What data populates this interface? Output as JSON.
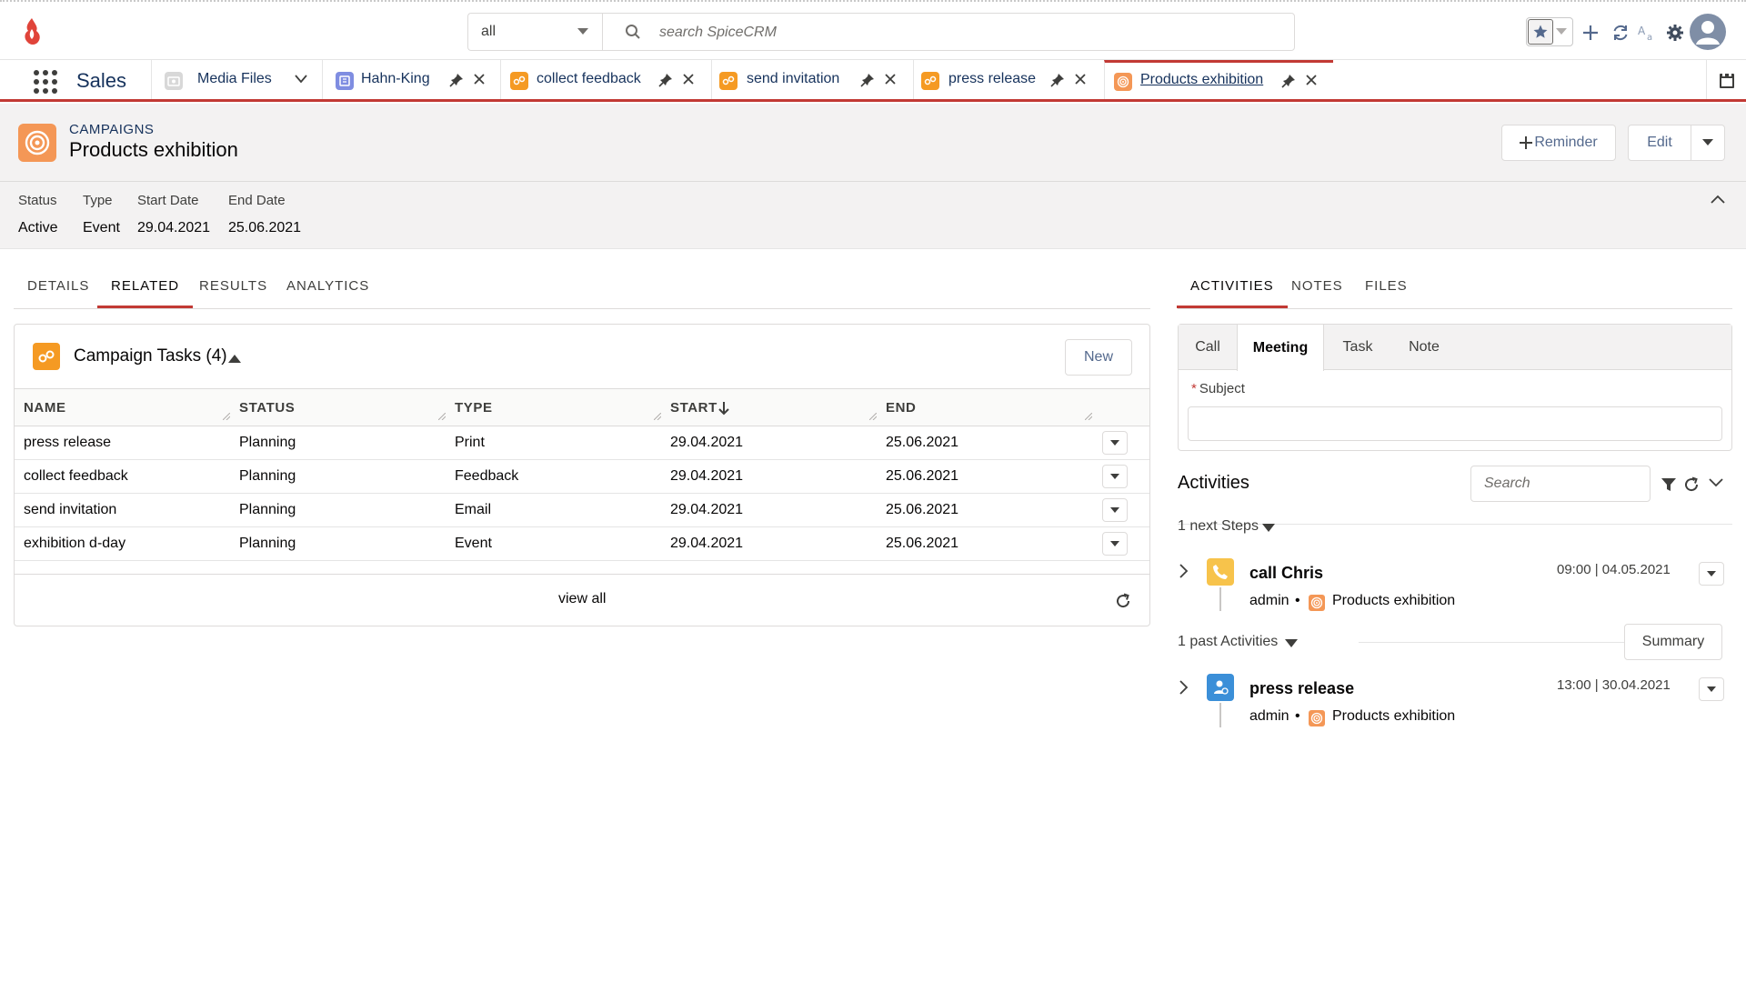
{
  "header": {
    "scope_value": "all",
    "search_placeholder": "search SpiceCRM",
    "logo_icon": "spicecrm-flame-logo",
    "icons": [
      "favorites-star-icon",
      "plus-icon",
      "refresh-icon",
      "language-icon",
      "gear-icon",
      "user-avatar-icon"
    ],
    "accent_color": "#c23934"
  },
  "appbar": {
    "app_name": "Sales",
    "tabs": [
      {
        "label": "Media Files",
        "icon": "media-files-icon"
      },
      {
        "label": "Hahn-King",
        "icon": "account-icon"
      },
      {
        "label": "collect feedback",
        "icon": "campaign-task-icon"
      },
      {
        "label": "send invitation",
        "icon": "campaign-task-icon"
      },
      {
        "label": "press release",
        "icon": "campaign-task-icon"
      },
      {
        "label": "Products exhibition",
        "icon": "campaign-icon"
      }
    ]
  },
  "record": {
    "module": "CAMPAIGNS",
    "name": "Products exhibition",
    "buttons": {
      "reminder": "Reminder",
      "edit": "Edit"
    },
    "fields": [
      {
        "label": "Status",
        "value": "Active"
      },
      {
        "label": "Type",
        "value": "Event"
      },
      {
        "label": "Start Date",
        "value": "29.04.2021"
      },
      {
        "label": "End Date",
        "value": "25.06.2021"
      }
    ]
  },
  "main_tabs": [
    "DETAILS",
    "RELATED",
    "RESULTS",
    "ANALYTICS"
  ],
  "main_tabs_active": "RELATED",
  "related": {
    "title": "Campaign Tasks (4)",
    "new_label": "New",
    "columns": [
      "NAME",
      "STATUS",
      "TYPE",
      "START",
      "END"
    ],
    "rows": [
      [
        "press release",
        "Planning",
        "Print",
        "29.04.2021",
        "25.06.2021"
      ],
      [
        "collect feedback",
        "Planning",
        "Feedback",
        "29.04.2021",
        "25.06.2021"
      ],
      [
        "send invitation",
        "Planning",
        "Email",
        "29.04.2021",
        "25.06.2021"
      ],
      [
        "exhibition d-day",
        "Planning",
        "Event",
        "29.04.2021",
        "25.06.2021"
      ]
    ],
    "view_all": "view all"
  },
  "side_tabs": [
    "ACTIVITIES",
    "NOTES",
    "FILES"
  ],
  "side_tabs_active": "ACTIVITIES",
  "composer": {
    "tabs": [
      "Call",
      "Meeting",
      "Task",
      "Note"
    ],
    "active": "Meeting",
    "subject_label": "Subject"
  },
  "activities": {
    "title": "Activities",
    "search_placeholder": "Search",
    "next_label": "1 next Steps",
    "past_label": "1 past Activities",
    "summary_label": "Summary",
    "next": {
      "title": "call Chris",
      "time": "09:00 | 04.05.2021",
      "user": "admin",
      "related": "Products exhibition",
      "icon": "phone-call-icon",
      "icon_color": "#f7c34b"
    },
    "past": {
      "title": "press release",
      "time": "13:00 | 30.04.2021",
      "user": "admin",
      "related": "Products exhibition",
      "icon": "task-user-icon",
      "icon_color": "#3b8fd8"
    }
  }
}
